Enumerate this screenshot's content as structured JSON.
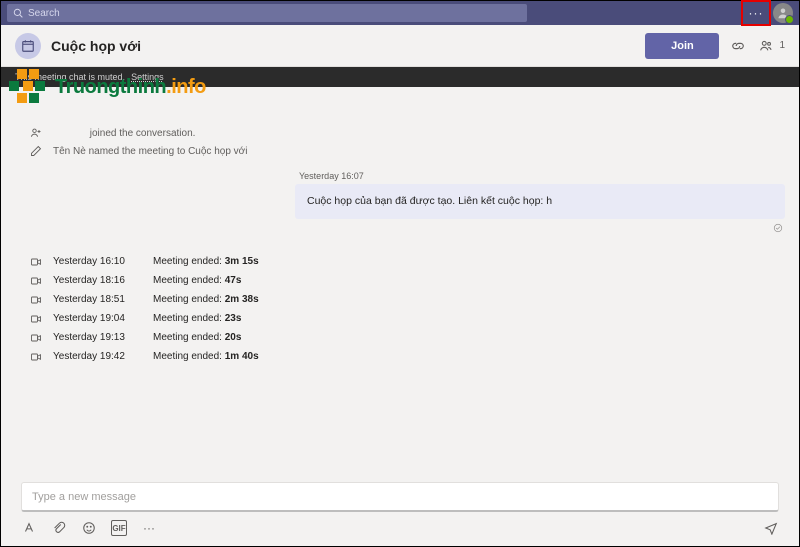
{
  "topbar": {
    "search_placeholder": "Search"
  },
  "meeting": {
    "title_prefix": "Cuộc họp với ",
    "join_label": "Join",
    "participants_count": "1"
  },
  "muted_bar": {
    "text": "This meeting chat is muted.",
    "link": "Settings"
  },
  "watermark": {
    "text_main": "Truongthinh",
    "text_suffix": ".info"
  },
  "system_events": {
    "joined_suffix": " joined the conversation.",
    "named_prefix": "Tên Nè named the meeting to Cuộc họp với "
  },
  "message": {
    "meta": "Yesterday 16:07",
    "body_prefix": "Cuộc họp của bạn đã được tạo. Liên kết cuộc họp: h"
  },
  "meeting_log": [
    {
      "time": "Yesterday 16:10",
      "label": "Meeting ended:",
      "duration": "3m 15s"
    },
    {
      "time": "Yesterday 18:16",
      "label": "Meeting ended:",
      "duration": "47s"
    },
    {
      "time": "Yesterday 18:51",
      "label": "Meeting ended:",
      "duration": "2m 38s"
    },
    {
      "time": "Yesterday 19:04",
      "label": "Meeting ended:",
      "duration": "23s"
    },
    {
      "time": "Yesterday 19:13",
      "label": "Meeting ended:",
      "duration": "20s"
    },
    {
      "time": "Yesterday 19:42",
      "label": "Meeting ended:",
      "duration": "1m 40s"
    }
  ],
  "compose": {
    "placeholder": "Type a new message",
    "gif_label": "GIF"
  }
}
